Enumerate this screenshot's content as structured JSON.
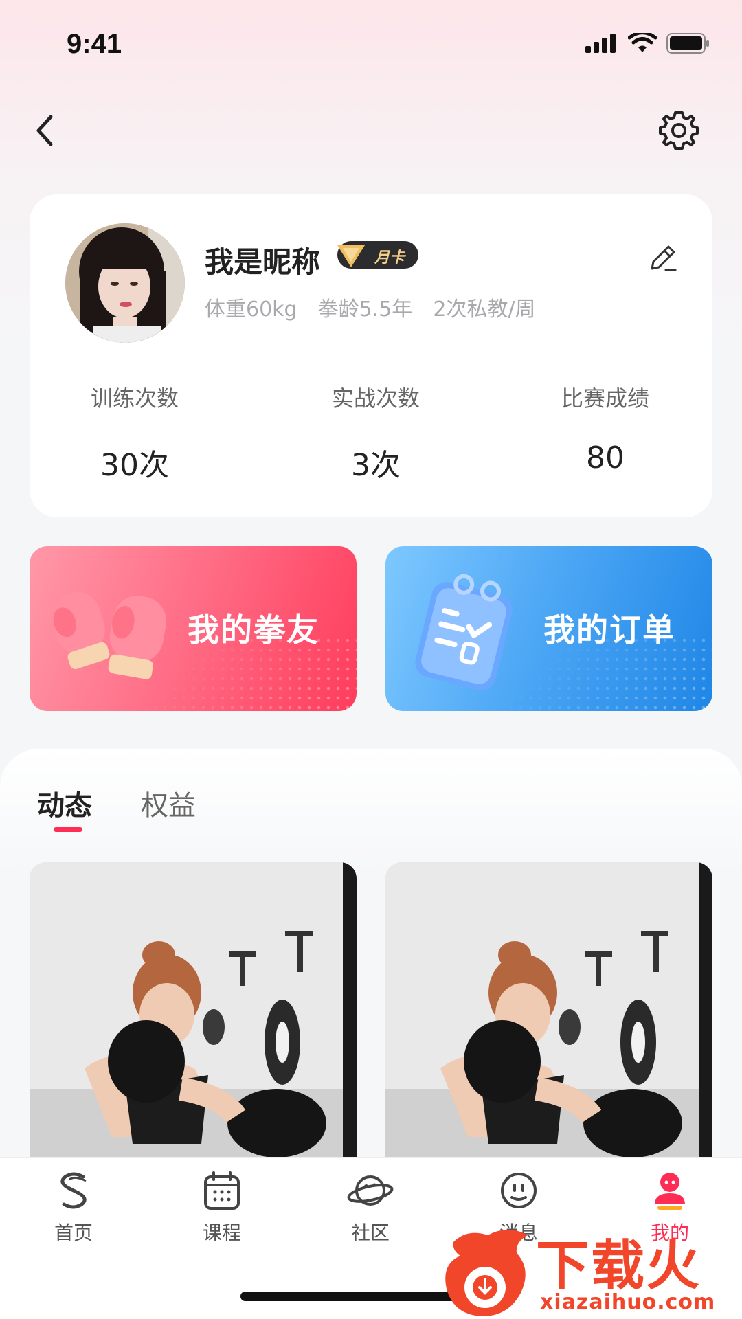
{
  "status_bar": {
    "time": "9:41"
  },
  "profile": {
    "nickname": "我是昵称",
    "badge": "月卡",
    "meta": [
      "体重60kg",
      "拳龄5.5年",
      "2次私教/周"
    ],
    "stats": [
      {
        "label": "训练次数",
        "value": "30次"
      },
      {
        "label": "实战次数",
        "value": "3次"
      },
      {
        "label": "比赛成绩",
        "value": "80"
      }
    ]
  },
  "actions": {
    "friends": "我的拳友",
    "orders": "我的订单"
  },
  "feed": {
    "tabs": [
      "动态",
      "权益"
    ]
  },
  "tab_bar": {
    "items": [
      {
        "label": "首页",
        "icon": "home-s-icon"
      },
      {
        "label": "课程",
        "icon": "calendar-icon"
      },
      {
        "label": "社区",
        "icon": "planet-icon"
      },
      {
        "label": "消息",
        "icon": "smiley-icon"
      },
      {
        "label": "我的",
        "icon": "user-icon"
      }
    ],
    "active_index": 4
  },
  "watermark": {
    "title": "下载火",
    "url": "xiazaihuo.com"
  },
  "colors": {
    "accent": "#ff2d55",
    "blue": "#1f86e6",
    "pink": "#ff3c5c"
  }
}
